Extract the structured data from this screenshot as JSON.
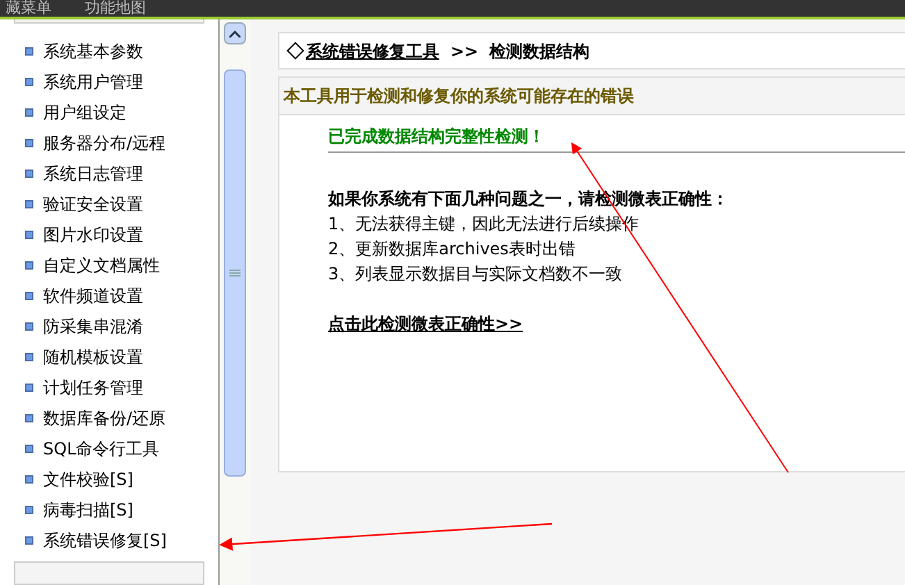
{
  "top_bar": {
    "items": [
      "藏菜单",
      "功能地图"
    ]
  },
  "sidebar": {
    "items": [
      "系统基本参数",
      "系统用户管理",
      "用户组设定",
      "服务器分布/远程",
      "系统日志管理",
      "验证安全设置",
      "图片水印设置",
      "自定义文档属性",
      "软件频道设置",
      "防采集串混淆",
      "随机模板设置",
      "计划任务管理",
      "数据库备份/还原",
      "SQL命令行工具",
      "文件校验[S]",
      "病毒扫描[S]",
      "系统错误修复[S]"
    ]
  },
  "breadcrumb": {
    "link": "系统错误修复工具",
    "separator": ">>",
    "current": "检测数据结构"
  },
  "panel": {
    "heading": "本工具用于检测和修复你的系统可能存在的错误",
    "status": "已完成数据结构完整性检测！",
    "intro": "如果你系统有下面几种问题之一，请检测微表正确性：",
    "problems": [
      "1、无法获得主键，因此无法进行后续操作",
      "2、更新数据库archives表时出错",
      "3、列表显示数据目与实际文档数不一致"
    ],
    "action_link": "点击此检测微表正确性>>"
  }
}
